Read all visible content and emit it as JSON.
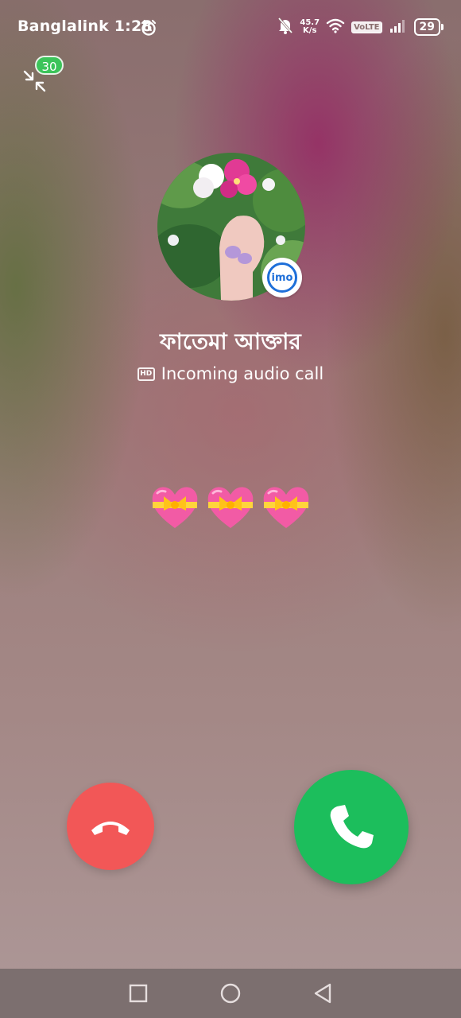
{
  "status_bar": {
    "carrier": "Banglalink 1:28",
    "network_speed_value": "45.7",
    "network_speed_unit": "K/s",
    "volte": "VoLTE",
    "battery": "29"
  },
  "minimize": {
    "badge": "30"
  },
  "caller": {
    "name": "ফাতেমা আক্তার",
    "app_badge": "imo",
    "hd_label": "HD",
    "call_status": "Incoming audio call"
  },
  "reaction": {
    "icon": "heart-with-ribbon-icon",
    "count": 3
  },
  "actions": {
    "decline_color": "#f25757",
    "accept_color": "#1cbe5c"
  },
  "colors": {
    "accent_green": "#3cc45a",
    "imo_blue": "#1e6fd9"
  }
}
